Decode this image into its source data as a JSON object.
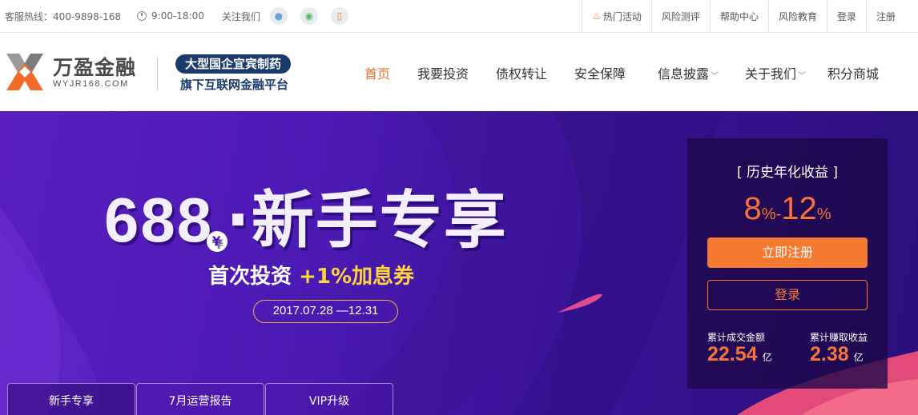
{
  "topbar": {
    "hotline": "客服热线：400-9898-168",
    "hours": "9:00-18:00",
    "follow_label": "关注我们",
    "social_icons": [
      "qq-icon",
      "wechat-icon",
      "phone-icon"
    ],
    "right_links": [
      "热门活动",
      "风险测评",
      "帮助中心",
      "风险教育",
      "登录",
      "注册"
    ]
  },
  "header": {
    "brand_cn": "万盈金融",
    "brand_en": "WYJR168.COM",
    "slogan_1": "大型国企宜宾制药",
    "slogan_2": "旗下互联网金融平台",
    "nav": [
      "首页",
      "我要投资",
      "债权转让",
      "安全保障",
      "信息披露",
      "关于我们",
      "积分商城"
    ],
    "nav_active": "首页",
    "accent_color": "#f26b2a",
    "brand_color": "#1b3a6e"
  },
  "banner": {
    "title_number": "688",
    "title_coin": "¥",
    "title_text": "·新手专享",
    "subtitle_prefix": "首次投资",
    "subtitle_highlight": "+1%加息券",
    "date_range": "2017.07.28 —12.31",
    "tabs": [
      "新手专享",
      "7月运营报告",
      "VIP升级"
    ],
    "active_tab": "新手专享"
  },
  "card": {
    "title": "[ 历史年化收益 ]",
    "rate_low": "8",
    "rate_low_unit": "%-",
    "rate_high": "12",
    "rate_high_unit": "%",
    "register_label": "立即注册",
    "login_label": "登录",
    "stat1_label": "累计成交金额",
    "stat1_value": "22.54",
    "stat1_unit": "亿",
    "stat2_label": "累计赚取收益",
    "stat2_value": "2.38",
    "stat2_unit": "亿"
  }
}
